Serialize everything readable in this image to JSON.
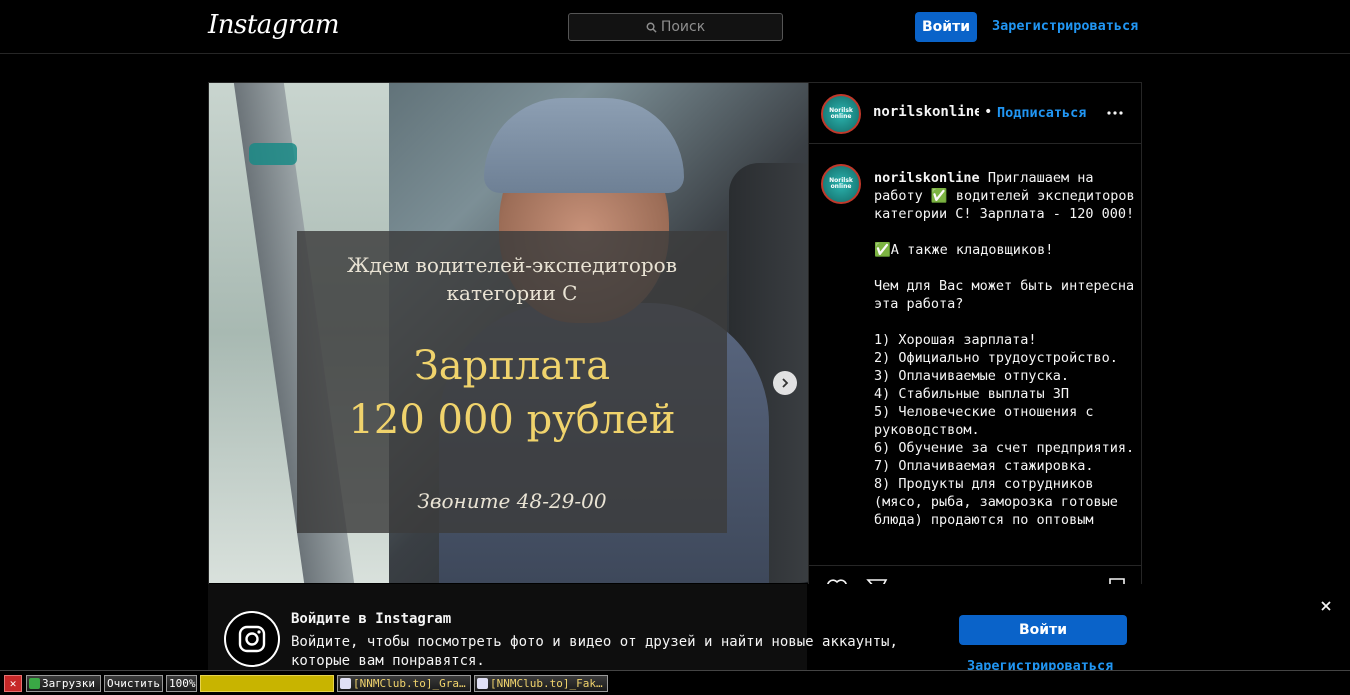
{
  "header": {
    "logo": "Instagram",
    "search_placeholder": "Поиск",
    "login_button": "Войти",
    "register_link": "Зарегистрироваться"
  },
  "post": {
    "image_overlay": {
      "line1": "Ждем водителей-экспедиторов",
      "line2": "категории С",
      "salary_line1": "Зарплата",
      "salary_line2": "120 000 рублей",
      "phone": "Звоните 48-29-00"
    },
    "author": {
      "username": "norilskonline",
      "avatar_text": "Norilsk online",
      "follow_label": "Подписаться",
      "separator": "•"
    },
    "caption_username": "norilskonline",
    "caption_text": "Приглашаем на работу ✅ водителей экспедиторов категории С! Зарплата - 120 000!\n\n✅А также кладовщиков!\n\nЧем для Вас может быть интересна эта работа?\n\n1) Хорошая зарплата!\n2) Официально трудоустройство.\n3) Оплачиваемые отпуска.\n4) Стабильные выплаты ЗП\n5) Человеческие отношения с руководством.\n6) Обучение за счет предприятия.\n7) Оплачиваемая стажировка.\n8) Продукты для сотрудников (мясо, рыба, заморозка готовые блюда) продаются по оптовым"
  },
  "login_banner": {
    "title": "Войдите в Instagram",
    "text": "Войдите, чтобы посмотреть фото и видео от друзей и найти новые аккаунты, которые вам понравятся.",
    "login_button": "Войти",
    "register_link": "Зарегистрироваться"
  },
  "taskbar": {
    "close_label": "✕",
    "downloads": "Загрузки",
    "clear": "Очистить",
    "zoom": "100%",
    "tab1": "[NNMClub.to]_Gra…",
    "tab2": "[NNMClub.to]_Fak…"
  },
  "colors": {
    "accent": "#0a63c9",
    "link": "#2196f3",
    "background": "#000000"
  }
}
